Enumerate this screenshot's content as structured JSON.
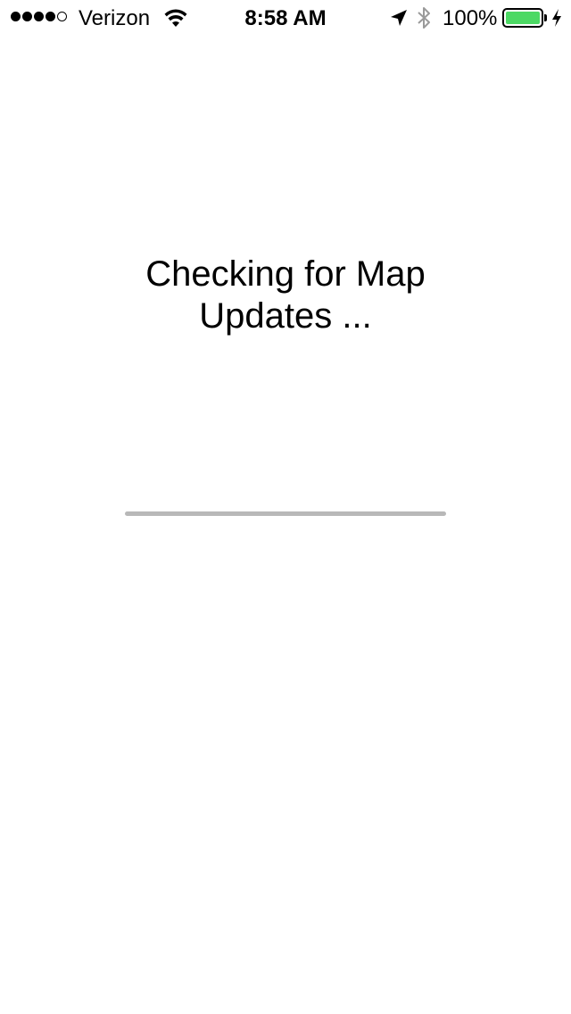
{
  "status_bar": {
    "signal_bars_filled": 4,
    "signal_bars_total": 5,
    "carrier": "Verizon",
    "wifi_icon": "wifi-icon",
    "time": "8:58 AM",
    "location_icon": "location-arrow-icon",
    "bluetooth_icon": "bluetooth-icon",
    "battery_percent": "100%",
    "battery_level": 1.0,
    "battery_color": "#4cd964",
    "charging_icon": "charging-bolt-icon"
  },
  "main": {
    "message_line1": "Checking for Map",
    "message_line2": "Updates ...",
    "progress": 0,
    "progress_track_color": "#b8b8b8"
  }
}
